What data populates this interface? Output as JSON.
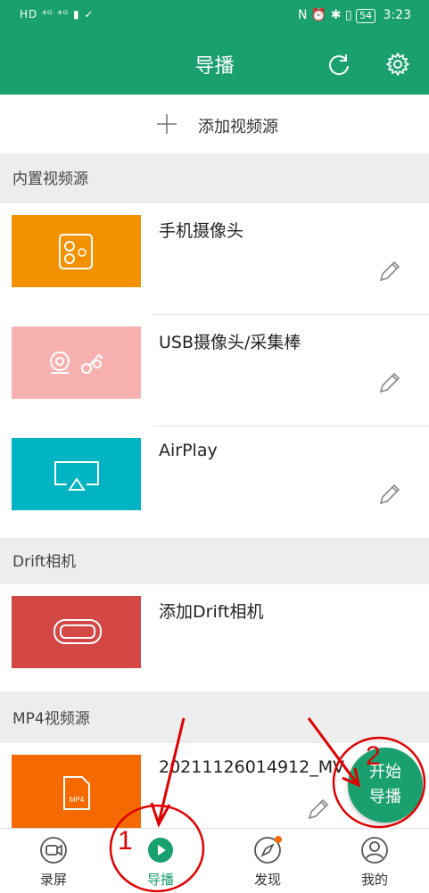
{
  "status_bar": {
    "left": "HD ⁴ᴳ ⁴ᴳ ▮ ✓",
    "battery": "54",
    "time": "3:23"
  },
  "header": {
    "title": "导播"
  },
  "add_source": {
    "label": "添加视频源"
  },
  "sections": {
    "builtin": "内置视频源",
    "drift": "Drift相机",
    "mp4": "MP4视频源"
  },
  "sources": {
    "phone_camera": "手机摄像头",
    "usb_camera": "USB摄像头/采集棒",
    "airplay": "AirPlay",
    "add_drift": "添加Drift相机",
    "mp4_file": "20211126014912_MV",
    "mp4_badge": "MP4"
  },
  "fab": {
    "line1": "开始",
    "line2": "导播"
  },
  "nav": {
    "record": "录屏",
    "direct": "导播",
    "discover": "发现",
    "mine": "我的"
  },
  "annotations": {
    "one": "1",
    "two": "2"
  },
  "colors": {
    "accent": "#1a9f6e",
    "phone_thumb": "#f39200",
    "usb_thumb": "#f8b1b1",
    "airplay_thumb": "#00b4c4",
    "drift_thumb": "#d34845",
    "mp4_thumb": "#f56a00",
    "annotation": "#e00000"
  }
}
